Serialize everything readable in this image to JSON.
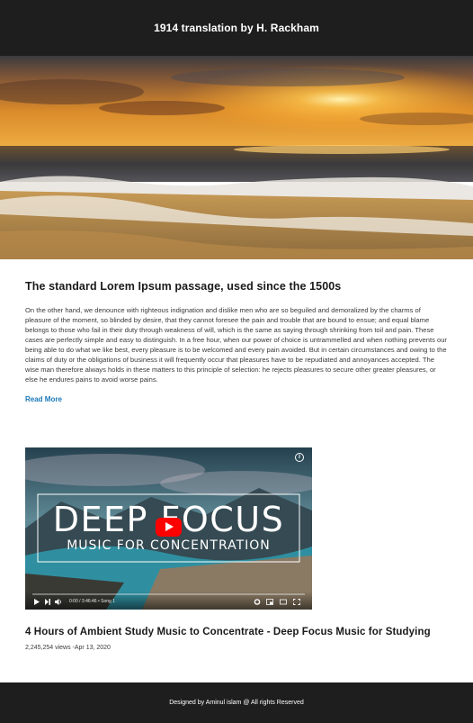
{
  "header": {
    "title": "1914 translation by H. Rackham"
  },
  "hero": {
    "image": "sunset-beach-photo"
  },
  "article": {
    "title": "The standard Lorem Ipsum passage, used since the 1500s",
    "body": "On the other hand, we denounce with righteous indignation and dislike men who are so beguiled and demoralized by the charms of pleasure of the moment, so blinded by desire, that they cannot foresee the pain and trouble that are bound to ensue; and equal blame belongs to those who fail in their duty through weakness of will, which is the same as saying through shrinking from toil and pain. These cases are perfectly simple and easy to distinguish. In a free hour, when our power of choice is untrammelled and when nothing prevents our being able to do what we like best, every pleasure is to be welcomed and every pain avoided. But in certain circumstances and owing to the claims of duty or the obligations of business it will frequently occur that pleasures have to be repudiated and annoyances accepted. The wise man therefore always holds in these matters to this principle of selection: he rejects pleasures to secure other greater pleasures, or else he endures pains to avoid worse pains.",
    "read_more": "Read More"
  },
  "video": {
    "thumbnail_title": "DEEP FOCUS",
    "thumbnail_subtitle": "MUSIC FOR CONCENTRATION",
    "info_label": "i",
    "time": "0:00 / 3:46:46 • Song 1",
    "progress": 0,
    "title": "4 Hours of Ambient Study Music to Concentrate - Deep Focus Music for Studying",
    "meta": "2,245,254 views -Apr 13, 2020"
  },
  "footer": {
    "text": "Designed  by Aminul islam @ All rights Reserved"
  },
  "colors": {
    "header_bg": "#1e1e1e",
    "link": "#1a78b8",
    "play": "#ff0000"
  }
}
